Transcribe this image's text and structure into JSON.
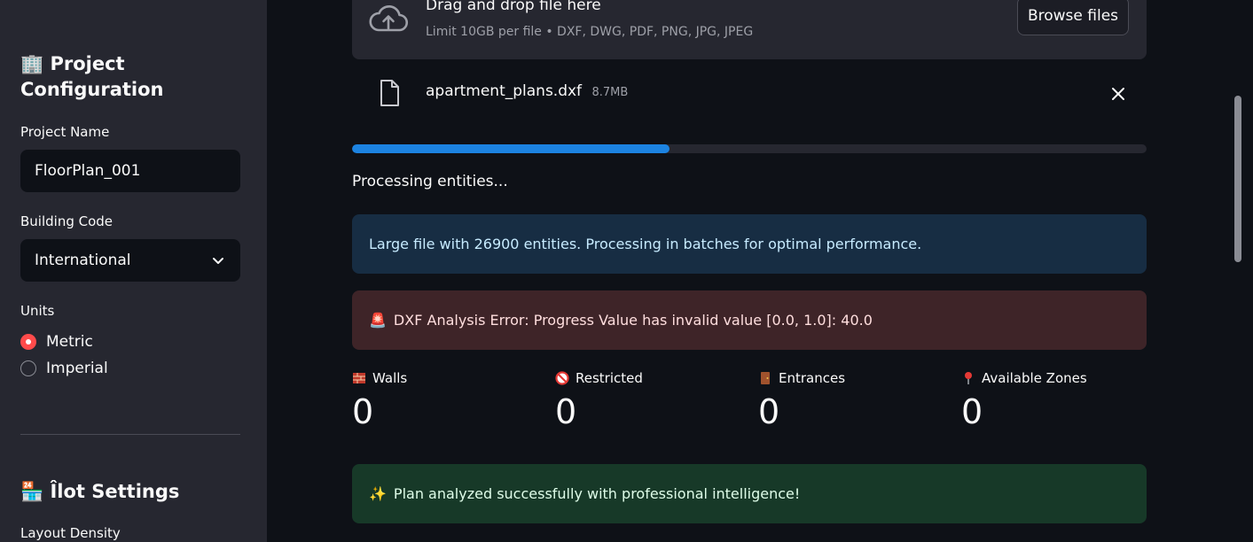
{
  "sidebar": {
    "project_title": "Project Configuration",
    "project_name_label": "Project Name",
    "project_name_value": "FloorPlan_001",
    "building_code_label": "Building Code",
    "building_code_value": "International",
    "units_label": "Units",
    "units_options": [
      "Metric",
      "Imperial"
    ],
    "units_selected": "Metric",
    "ilot_title": "Îlot Settings",
    "layout_density_label": "Layout Density"
  },
  "uploader": {
    "title": "Drag and drop file here",
    "subtitle": "Limit 10GB per file • DXF, DWG, PDF, PNG, JPG, JPEG",
    "browse_label": "Browse files"
  },
  "file": {
    "name": "apartment_plans.dxf",
    "size": "8.7MB"
  },
  "progress": {
    "fraction": 0.4
  },
  "status_text": "Processing entities...",
  "alerts": {
    "info": "Large file with 26900 entities. Processing in batches for optimal performance.",
    "error": "DXF Analysis Error: Progress Value has invalid value [0.0, 1.0]: 40.0",
    "success": "Plan analyzed successfully with professional intelligence!"
  },
  "metrics": [
    {
      "label": "Walls",
      "value": "0",
      "icon": "brick-icon"
    },
    {
      "label": "Restricted",
      "value": "0",
      "icon": "no-entry-icon"
    },
    {
      "label": "Entrances",
      "value": "0",
      "icon": "door-icon"
    },
    {
      "label": "Available Zones",
      "value": "0",
      "icon": "pin-icon"
    }
  ],
  "colors": {
    "accent_red": "#ff4b4b",
    "progress_blue": "#1c83e1",
    "sidebar_bg": "#262730",
    "main_bg": "#0e1117"
  }
}
